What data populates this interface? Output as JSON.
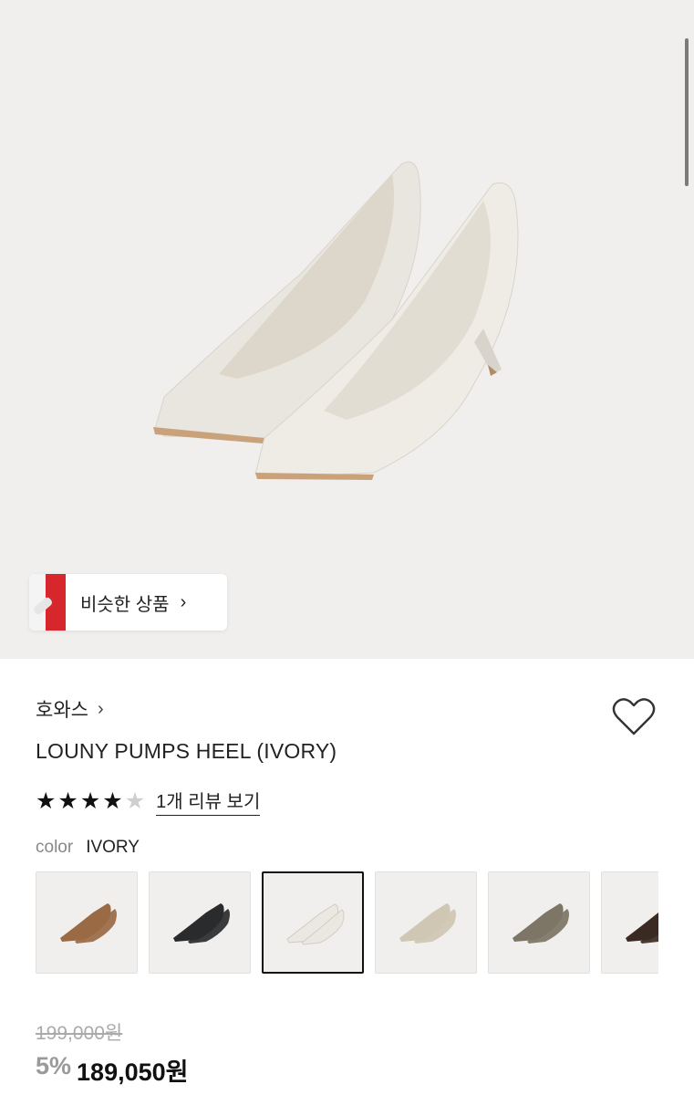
{
  "hero": {
    "similar_button": {
      "label": "비슷한 상품",
      "chevron": "chevron-right-icon"
    }
  },
  "product": {
    "brand": "호와스",
    "brand_chevron": "chevron-right-icon",
    "title": "LOUNY PUMPS HEEL (IVORY)",
    "rating": {
      "value": 4,
      "max": 5,
      "review_link": "1개 리뷰 보기"
    },
    "wishlist_icon": "heart-icon",
    "color": {
      "label": "color",
      "value": "IVORY"
    },
    "swatches": [
      {
        "name": "brown",
        "color": "#9a6a45"
      },
      {
        "name": "black",
        "color": "#2a2b2c"
      },
      {
        "name": "ivory",
        "color": "#ebe8e2",
        "selected": true
      },
      {
        "name": "beige",
        "color": "#cfc6b3"
      },
      {
        "name": "khaki",
        "color": "#7d7565"
      },
      {
        "name": "dark-brown",
        "color": "#3b2a22"
      }
    ],
    "price": {
      "original": "199,000원",
      "discount": "5%",
      "final": "189,050원"
    }
  },
  "colors": {
    "hero_bg": "#f1efed",
    "text": "#1a1a1a"
  }
}
